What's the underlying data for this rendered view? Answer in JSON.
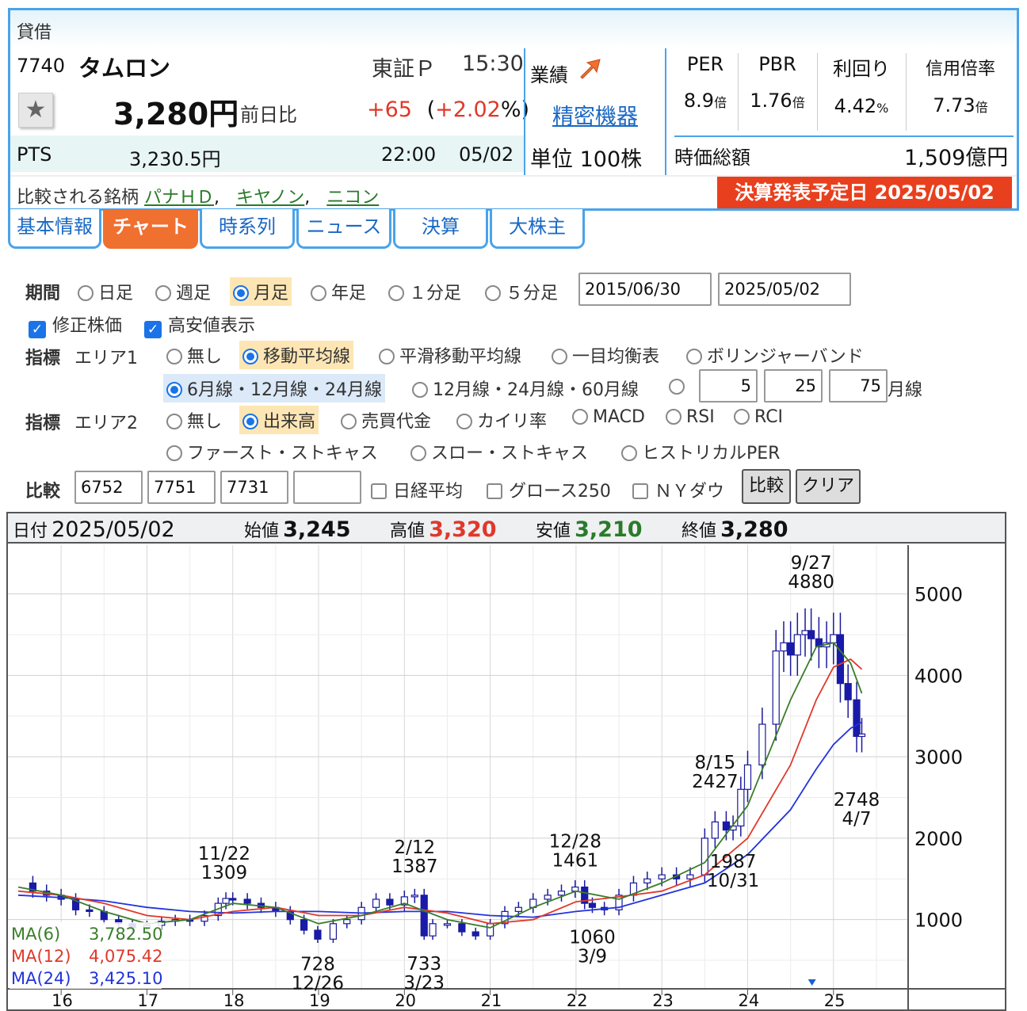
{
  "header": {
    "category": "貸借"
  },
  "stock": {
    "code": "7740",
    "name": "タムロン",
    "market": "東証Ｐ",
    "time": "15:30",
    "price": "3,280円",
    "change_label": "前日比",
    "change": "+65",
    "change_pct_open": "(",
    "change_pct": "+2.02",
    "change_pct_close": "%)"
  },
  "pts": {
    "label": "PTS",
    "price": "3,230.5円",
    "time": "22:00",
    "date": "05/02"
  },
  "compare": {
    "label": "比較される銘柄",
    "items": [
      "パナＨＤ",
      "キヤノン",
      "ニコン"
    ],
    "sep": ","
  },
  "earnings": {
    "label": "業績",
    "icon": "arrow-up-right-icon",
    "sector": "精密機器",
    "unit": "単位 100株"
  },
  "metrics": [
    {
      "label": "PER",
      "value": "8.9",
      "unit": "倍"
    },
    {
      "label": "PBR",
      "value": "1.76",
      "unit": "倍"
    },
    {
      "label": "利回り",
      "value": "4.42",
      "unit": "%"
    },
    {
      "label": "信用倍率",
      "value": "7.73",
      "unit": "倍"
    }
  ],
  "market_cap": {
    "label": "時価総額",
    "value": "1,509億円"
  },
  "announce": {
    "text": "決算発表予定日 2025/05/02",
    "color": "#e8401e"
  },
  "tabs": [
    "基本情報",
    "チャート",
    "時系列",
    "ニュース",
    "決算",
    "大株主"
  ],
  "period": {
    "label": "期間",
    "options": [
      "日足",
      "週足",
      "月足",
      "年足",
      "１分足",
      "５分足"
    ],
    "selected": "月足",
    "from": "2015/06/30",
    "to": "2025/05/02"
  },
  "checks": [
    {
      "label": "修正株価",
      "checked": true
    },
    {
      "label": "高安値表示",
      "checked": true
    }
  ],
  "area1": {
    "label": "指標",
    "sub": "エリア1",
    "options": [
      "無し",
      "移動平均線",
      "平滑移動平均線",
      "一目均衡表",
      "ボリンジャーバンド"
    ],
    "selected": "移動平均線",
    "ma_options": [
      "6月線・12月線・24月線",
      "12月線・24月線・60月線"
    ],
    "custom": [
      "5",
      "25",
      "75"
    ],
    "custom_unit": "月線"
  },
  "area2": {
    "label": "指標",
    "sub": "エリア2",
    "options": [
      "無し",
      "出来高",
      "売買代金",
      "カイリ率",
      "MACD",
      "RSI",
      "RCI"
    ],
    "options2": [
      "ファースト・ストキャス",
      "スロー・ストキャス",
      "ヒストリカルPER"
    ],
    "selected": "出来高"
  },
  "compare_form": {
    "label": "比較",
    "codes": [
      "6752",
      "7751",
      "7731",
      ""
    ],
    "indices": [
      "日経平均",
      "グロース250",
      "ＮＹダウ"
    ],
    "compare_button": "比較",
    "clear_button": "クリア"
  },
  "ohlc": {
    "date_label": "日付",
    "date": "2025/05/02",
    "open_label": "始値",
    "open": "3,245",
    "high_label": "高値",
    "high": "3,320",
    "low_label": "安値",
    "low": "3,210",
    "close_label": "終値",
    "close": "3,280"
  },
  "chart_data": {
    "type": "candlestick",
    "y_ticks": [
      1000,
      2000,
      3000,
      4000,
      5000
    ],
    "ylim": [
      150,
      5600
    ],
    "x_year_ticks": [
      "16",
      "17",
      "18",
      "19",
      "20",
      "21",
      "22",
      "23",
      "24",
      "25"
    ],
    "annotations": [
      {
        "label": "11/22",
        "value": "1309",
        "x": 2017.9,
        "y": 1309
      },
      {
        "label": "12/26",
        "value": "728",
        "x": 2018.99,
        "y": 728
      },
      {
        "label": "2/12",
        "value": "1387",
        "x": 2020.12,
        "y": 1387
      },
      {
        "label": "3/23",
        "value": "733",
        "x": 2020.23,
        "y": 733
      },
      {
        "label": "12/28",
        "value": "1461",
        "x": 2021.99,
        "y": 1461
      },
      {
        "label": "3/9",
        "value": "1060",
        "x": 2022.19,
        "y": 1060
      },
      {
        "label": "8/15",
        "value": "2427",
        "x": 2023.62,
        "y": 2427
      },
      {
        "label": "10/31",
        "value": "1987",
        "x": 2023.83,
        "y": 1987
      },
      {
        "label": "9/27",
        "value": "4880",
        "x": 2024.74,
        "y": 4880
      },
      {
        "label": "4/7",
        "value": "2748",
        "x": 2025.27,
        "y": 2748
      }
    ],
    "ma_legend": [
      {
        "name": "MA(6)",
        "value": "3,782.50",
        "color": "#3a7d2a"
      },
      {
        "name": "MA(12)",
        "value": "4,075.42",
        "color": "#e0382b"
      },
      {
        "name": "MA(24)",
        "value": "3,425.10",
        "color": "#2233dd"
      }
    ],
    "close_series": [
      [
        2015.5,
        1450
      ],
      [
        2015.67,
        1350
      ],
      [
        2015.83,
        1300
      ],
      [
        2016.0,
        1250
      ],
      [
        2016.17,
        1120
      ],
      [
        2016.33,
        1100
      ],
      [
        2016.5,
        1000
      ],
      [
        2016.67,
        950
      ],
      [
        2016.83,
        900
      ],
      [
        2017.0,
        930
      ],
      [
        2017.17,
        980
      ],
      [
        2017.33,
        1000
      ],
      [
        2017.5,
        980
      ],
      [
        2017.67,
        1050
      ],
      [
        2017.83,
        1200
      ],
      [
        2017.92,
        1260
      ],
      [
        2018.0,
        1250
      ],
      [
        2018.17,
        1200
      ],
      [
        2018.33,
        1150
      ],
      [
        2018.5,
        1100
      ],
      [
        2018.67,
        1000
      ],
      [
        2018.83,
        870
      ],
      [
        2018.99,
        760
      ],
      [
        2019.17,
        950
      ],
      [
        2019.33,
        1000
      ],
      [
        2019.5,
        1150
      ],
      [
        2019.67,
        1250
      ],
      [
        2019.83,
        1180
      ],
      [
        2020.0,
        1280
      ],
      [
        2020.12,
        1300
      ],
      [
        2020.23,
        800
      ],
      [
        2020.33,
        950
      ],
      [
        2020.5,
        950
      ],
      [
        2020.67,
        850
      ],
      [
        2020.83,
        800
      ],
      [
        2021.0,
        950
      ],
      [
        2021.17,
        1100
      ],
      [
        2021.33,
        1150
      ],
      [
        2021.5,
        1250
      ],
      [
        2021.67,
        1300
      ],
      [
        2021.83,
        1350
      ],
      [
        2021.99,
        1400
      ],
      [
        2022.1,
        1200
      ],
      [
        2022.19,
        1150
      ],
      [
        2022.33,
        1120
      ],
      [
        2022.5,
        1300
      ],
      [
        2022.67,
        1450
      ],
      [
        2022.83,
        1500
      ],
      [
        2023.0,
        1550
      ],
      [
        2023.17,
        1500
      ],
      [
        2023.33,
        1550
      ],
      [
        2023.5,
        2000
      ],
      [
        2023.62,
        2200
      ],
      [
        2023.75,
        2100
      ],
      [
        2023.83,
        2150
      ],
      [
        2023.92,
        2600
      ],
      [
        2024.0,
        2900
      ],
      [
        2024.17,
        3400
      ],
      [
        2024.33,
        4300
      ],
      [
        2024.42,
        4400
      ],
      [
        2024.5,
        4250
      ],
      [
        2024.58,
        4500
      ],
      [
        2024.67,
        4550
      ],
      [
        2024.74,
        4450
      ],
      [
        2024.83,
        4350
      ],
      [
        2024.92,
        4400
      ],
      [
        2025.0,
        4500
      ],
      [
        2025.08,
        3900
      ],
      [
        2025.17,
        3700
      ],
      [
        2025.27,
        3250
      ],
      [
        2025.33,
        3280
      ]
    ],
    "ma6": [
      [
        2015.5,
        1400
      ],
      [
        2016.0,
        1300
      ],
      [
        2016.5,
        1100
      ],
      [
        2017.0,
        950
      ],
      [
        2017.5,
        1000
      ],
      [
        2018.0,
        1200
      ],
      [
        2018.5,
        1150
      ],
      [
        2019.0,
        950
      ],
      [
        2019.5,
        1050
      ],
      [
        2020.0,
        1200
      ],
      [
        2020.5,
        1000
      ],
      [
        2021.0,
        900
      ],
      [
        2021.5,
        1150
      ],
      [
        2022.0,
        1350
      ],
      [
        2022.5,
        1250
      ],
      [
        2023.0,
        1450
      ],
      [
        2023.5,
        1700
      ],
      [
        2024.0,
        2400
      ],
      [
        2024.5,
        3700
      ],
      [
        2024.8,
        4350
      ],
      [
        2025.0,
        4400
      ],
      [
        2025.2,
        4150
      ],
      [
        2025.33,
        3780
      ]
    ],
    "ma12": [
      [
        2015.5,
        1350
      ],
      [
        2016.0,
        1300
      ],
      [
        2016.5,
        1200
      ],
      [
        2017.0,
        1050
      ],
      [
        2017.5,
        1000
      ],
      [
        2018.0,
        1100
      ],
      [
        2018.5,
        1150
      ],
      [
        2019.0,
        1050
      ],
      [
        2019.5,
        1050
      ],
      [
        2020.0,
        1150
      ],
      [
        2020.5,
        1080
      ],
      [
        2021.0,
        950
      ],
      [
        2021.5,
        1000
      ],
      [
        2022.0,
        1220
      ],
      [
        2022.5,
        1280
      ],
      [
        2023.0,
        1350
      ],
      [
        2023.5,
        1550
      ],
      [
        2024.0,
        2000
      ],
      [
        2024.5,
        2900
      ],
      [
        2024.8,
        3700
      ],
      [
        2025.0,
        4100
      ],
      [
        2025.2,
        4200
      ],
      [
        2025.33,
        4075
      ]
    ],
    "ma24": [
      [
        2015.5,
        1300
      ],
      [
        2016.0,
        1270
      ],
      [
        2016.5,
        1230
      ],
      [
        2017.0,
        1150
      ],
      [
        2017.5,
        1100
      ],
      [
        2018.0,
        1080
      ],
      [
        2018.5,
        1100
      ],
      [
        2019.0,
        1100
      ],
      [
        2019.5,
        1080
      ],
      [
        2020.0,
        1100
      ],
      [
        2020.5,
        1100
      ],
      [
        2021.0,
        1050
      ],
      [
        2021.5,
        1030
      ],
      [
        2022.0,
        1100
      ],
      [
        2022.5,
        1150
      ],
      [
        2023.0,
        1300
      ],
      [
        2023.5,
        1450
      ],
      [
        2024.0,
        1800
      ],
      [
        2024.5,
        2350
      ],
      [
        2024.8,
        2850
      ],
      [
        2025.0,
        3150
      ],
      [
        2025.2,
        3350
      ],
      [
        2025.33,
        3425
      ]
    ]
  }
}
